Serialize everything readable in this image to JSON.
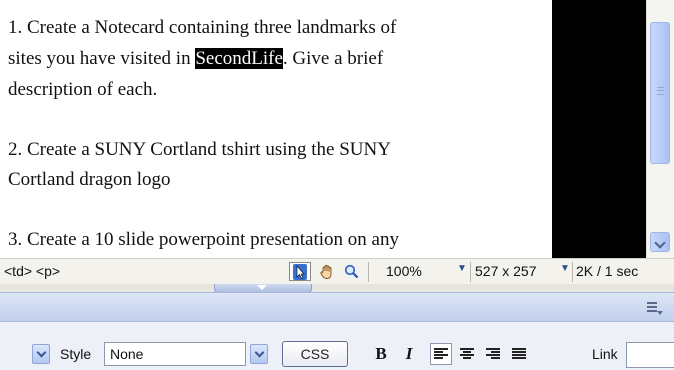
{
  "document": {
    "p1_line1": "1. Create a Notecard containing three landmarks of",
    "p1_line2_pre": "sites you have visited in ",
    "p1_line2_highlight": "SecondLife",
    "p1_line2_post": ". Give a brief",
    "p1_line3": "description of each.",
    "p2_line1": "2. Create a SUNY Cortland tshirt using the SUNY",
    "p2_line2": "Cortland dragon logo",
    "p3_line1": "3. Create a 10 slide powerpoint presentation on any"
  },
  "status_bar": {
    "tag_selector": "<td> <p>",
    "zoom": "100%",
    "window_size": "527 x 257",
    "download_info": "2K / 1 sec",
    "tools": [
      "pointer-icon",
      "hand-icon",
      "zoom-icon"
    ]
  },
  "properties": {
    "style_label": "Style",
    "style_value": "None",
    "css_button": "CSS",
    "bold": "B",
    "italic": "I",
    "link_label": "Link",
    "link_value": ""
  },
  "colors": {
    "highlight_bg": "#000000",
    "scroll_thumb": "#b7cbf6",
    "panel_header": "#c2d0ec"
  }
}
